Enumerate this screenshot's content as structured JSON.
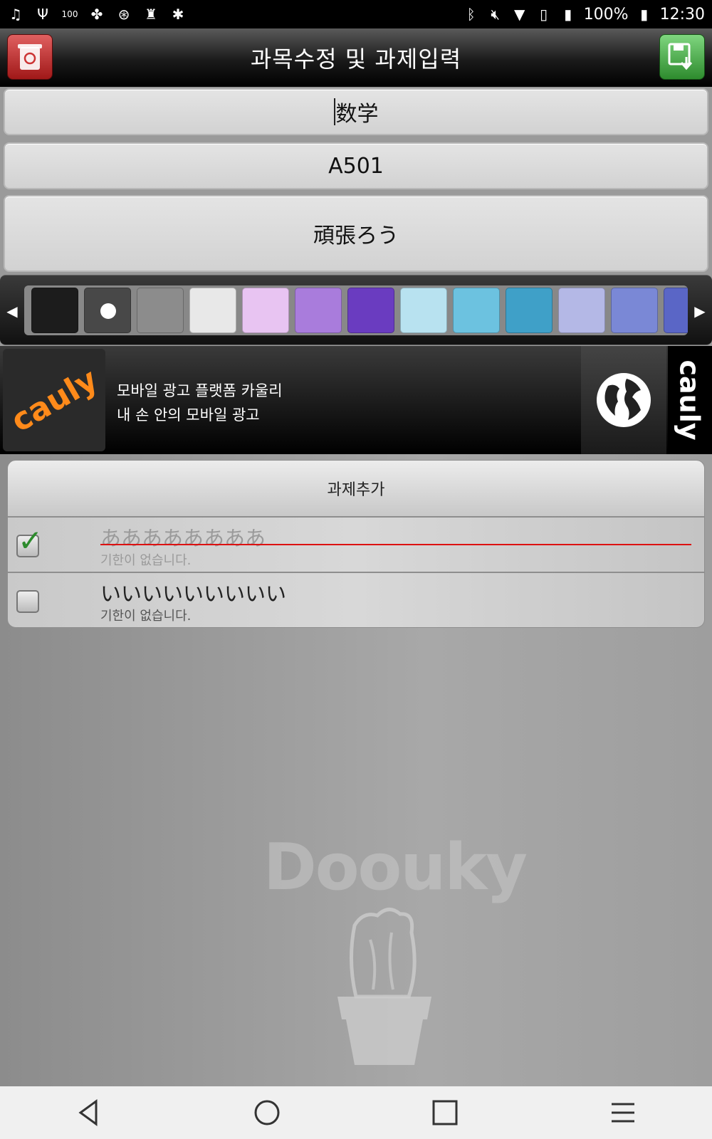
{
  "status_bar": {
    "battery": "100%",
    "time": "12:30",
    "icons_left": [
      "music-icon",
      "usb-icon",
      "battery-100-icon",
      "fan-icon",
      "android-debug-icon",
      "keyhole-icon",
      "bug-icon"
    ],
    "icons_right": [
      "bluetooth-icon",
      "mute-icon",
      "wifi-icon",
      "no-sim-icon",
      "signal-icon",
      "battery-charging-icon"
    ]
  },
  "header": {
    "title": "과목수정 및 과제입력",
    "delete_icon": "trash-icon",
    "save_icon": "save-download-icon"
  },
  "form": {
    "subject": "数学",
    "room": "A501",
    "memo": "頑張ろう"
  },
  "palette": {
    "colors": [
      "#1c1c1c",
      "#484848",
      "#8c8c8c",
      "#e8e8e8",
      "#e8c4f2",
      "#a97cdc",
      "#6a3cc0",
      "#b8e2f0",
      "#6cc2e0",
      "#3fa0c8",
      "#b4b8e6",
      "#7a88d6",
      "#5a66c6"
    ],
    "selected_index": 1
  },
  "ad": {
    "logo_text": "cauly",
    "line1": "모바일 광고 플랫폼 카울리",
    "line2": "내 손 안의 모바일 광고",
    "brand_text": "cauly"
  },
  "tasks": {
    "add_label": "과제추가",
    "items": [
      {
        "title": "ああああああああ",
        "due": "기한이 없습니다.",
        "done": true
      },
      {
        "title": "いいいいいいいいい",
        "due": "기한이 없습니다.",
        "done": false
      }
    ]
  },
  "watermark": "Doouky",
  "nav": [
    "back-icon",
    "home-icon",
    "recents-icon",
    "menu-icon"
  ]
}
